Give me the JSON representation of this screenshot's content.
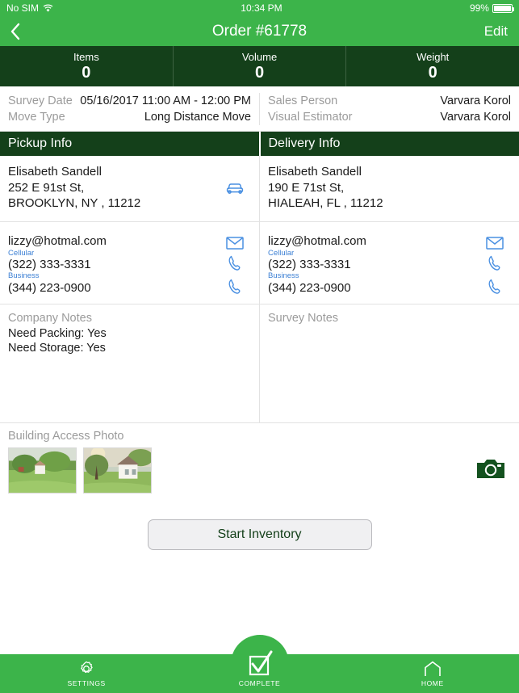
{
  "statusbar": {
    "carrier": "No SIM",
    "wifi_icon": "wifi-icon",
    "time": "10:34 PM",
    "battery_text": "99%",
    "battery_percent": 99
  },
  "navbar": {
    "back_icon": "chevron-left-icon",
    "title": "Order #61778",
    "edit_label": "Edit"
  },
  "stats": [
    {
      "label": "Items",
      "value": "0"
    },
    {
      "label": "Volume",
      "value": "0"
    },
    {
      "label": "Weight",
      "value": "0"
    }
  ],
  "meta": {
    "left": [
      {
        "key": "Survey Date",
        "value": "05/16/2017 11:00 AM - 12:00 PM"
      },
      {
        "key": "Move Type",
        "value": "Long Distance Move"
      }
    ],
    "right": [
      {
        "key": "Sales Person",
        "value": "Varvara Korol"
      },
      {
        "key": "Visual Estimator",
        "value": "Varvara Korol"
      }
    ]
  },
  "sections": {
    "pickup_title": "Pickup Info",
    "delivery_title": "Delivery Info"
  },
  "pickup": {
    "name": "Elisabeth Sandell",
    "address_line1": "252 E 91st St,",
    "address_line2": "BROOKLYN, NY , 11212",
    "vehicle_icon": "car-icon",
    "email": "lizzy@hotmal.com",
    "email_icon": "envelope-icon",
    "cellular_label": "Cellular",
    "cellular_number": "(322) 333-3331",
    "cellular_icon": "phone-icon",
    "business_label": "Business",
    "business_number": "(344) 223-0900",
    "business_icon": "phone-icon",
    "notes_title": "Company Notes",
    "notes_lines": [
      "Need Packing: Yes",
      "Need Storage: Yes"
    ]
  },
  "delivery": {
    "name": "Elisabeth Sandell",
    "address_line1": "190 E 71st St,",
    "address_line2": "HIALEAH, FL , 11212",
    "email": "lizzy@hotmal.com",
    "email_icon": "envelope-icon",
    "cellular_label": "Cellular",
    "cellular_number": "(322) 333-3331",
    "cellular_icon": "phone-icon",
    "business_label": "Business",
    "business_number": "(344) 223-0900",
    "business_icon": "phone-icon",
    "notes_title": "Survey Notes",
    "notes_lines": []
  },
  "photos": {
    "title": "Building Access Photo",
    "camera_icon": "camera-icon",
    "items": [
      {
        "alt": "house-with-trees-photo"
      },
      {
        "alt": "white-house-photo"
      }
    ]
  },
  "action": {
    "start_inventory_label": "Start Inventory"
  },
  "tabbar": {
    "settings_label": "SETTINGS",
    "settings_icon": "gear-icon",
    "complete_label": "COMPLETE",
    "complete_icon": "checkbox-check-icon",
    "home_label": "HOME",
    "home_icon": "home-icon"
  },
  "colors": {
    "brand_green": "#3cb44a",
    "dark_green": "#14401a",
    "link_blue": "#3b7fd4",
    "muted_gray": "#9b9b9b"
  }
}
